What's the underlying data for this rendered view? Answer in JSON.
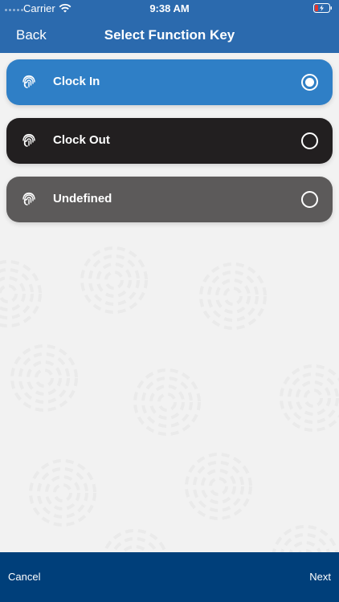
{
  "status_bar": {
    "carrier": "Carrier",
    "time": "9:38 AM",
    "wifi_icon": "wifi-icon",
    "battery_icon": "battery-charging-icon"
  },
  "navbar": {
    "back_label": "Back",
    "title": "Select Function Key"
  },
  "options": [
    {
      "label": "Clock In",
      "icon": "fingerprint-icon",
      "selected": true,
      "color": "#2f7fc6"
    },
    {
      "label": "Clock Out",
      "icon": "fingerprint-icon",
      "selected": false,
      "color": "#221f20"
    },
    {
      "label": "Undefined",
      "icon": "fingerprint-icon",
      "selected": false,
      "color": "#5c5a5a"
    }
  ],
  "footer": {
    "cancel_label": "Cancel",
    "next_label": "Next"
  },
  "colors": {
    "header": "#2b6aae",
    "footer": "#003f7a",
    "background": "#f2f2f2"
  }
}
